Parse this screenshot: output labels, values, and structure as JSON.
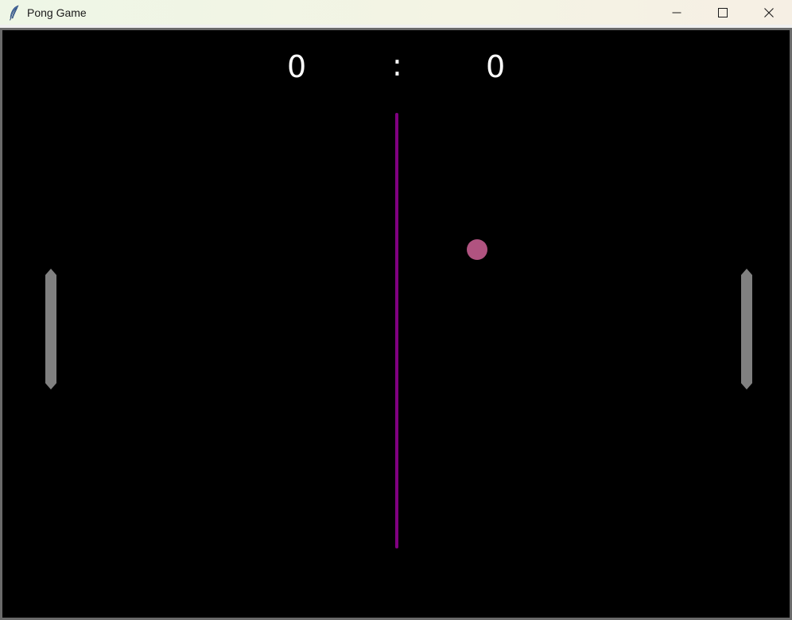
{
  "window": {
    "title": "Pong Game",
    "app_icon": "feather-icon",
    "controls": {
      "minimize_icon": "minimize-icon",
      "maximize_icon": "maximize-icon",
      "close_icon": "close-icon"
    }
  },
  "game": {
    "score_left": "0",
    "score_separator": ":",
    "score_right": "0",
    "colors": {
      "background": "#000000",
      "net": "#800080",
      "ball": "#b05380",
      "paddle": "#808080",
      "score_text": "#ffffff"
    }
  }
}
